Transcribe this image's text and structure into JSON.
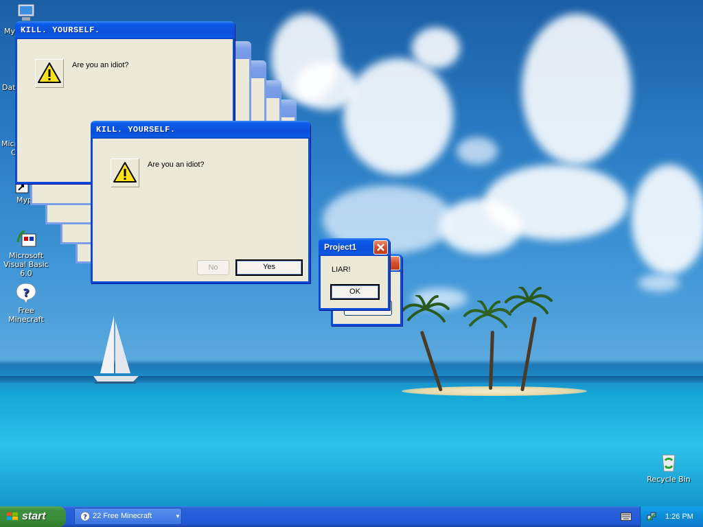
{
  "desktop": {
    "icons": [
      {
        "label": "My",
        "icon": "my-computer-icon"
      },
      {
        "label": "Dat",
        "icon": "document-icon"
      },
      {
        "label": "Micro",
        "label2": "C",
        "icon": "app-icon"
      },
      {
        "label": "Myp",
        "icon": "shortcut-icon"
      },
      {
        "label": "Microsoft Visual Basic 6.0",
        "icon": "visual-basic-icon"
      },
      {
        "label": "Free Minecraft",
        "icon": "help-question-icon"
      },
      {
        "label": "Recycle Bin",
        "icon": "recycle-bin-icon"
      }
    ]
  },
  "dialogs": {
    "kill_title": "KILL. YOURSELF.",
    "question": "Are you an idiot?",
    "no_label": "No",
    "yes_label": "Yes"
  },
  "project_dialog": {
    "title": "Project1",
    "message": "LIAR!",
    "ok_label": "OK"
  },
  "taskbar": {
    "start_label": "start",
    "task_label": "22 Free Minecraft",
    "clock": "1:26 PM"
  },
  "colors": {
    "title_active": "#0a4fd8",
    "title_inactive": "#7d9fe6",
    "window_face": "#ece9d8",
    "taskbar": "#245ddb",
    "start_green": "#3a8e3a"
  }
}
